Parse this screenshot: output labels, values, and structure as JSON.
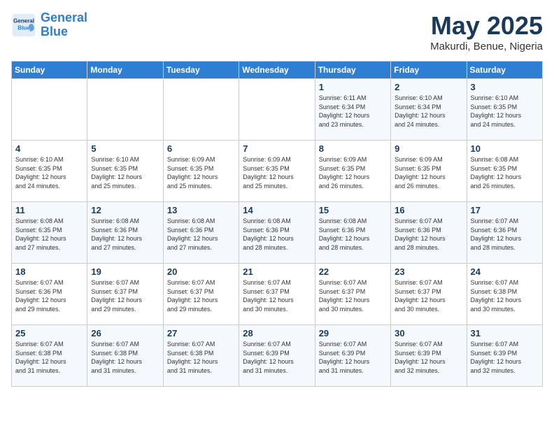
{
  "header": {
    "logo_line1": "General",
    "logo_line2": "Blue",
    "month": "May 2025",
    "location": "Makurdi, Benue, Nigeria"
  },
  "weekdays": [
    "Sunday",
    "Monday",
    "Tuesday",
    "Wednesday",
    "Thursday",
    "Friday",
    "Saturday"
  ],
  "weeks": [
    [
      {
        "day": "",
        "info": ""
      },
      {
        "day": "",
        "info": ""
      },
      {
        "day": "",
        "info": ""
      },
      {
        "day": "",
        "info": ""
      },
      {
        "day": "1",
        "info": "Sunrise: 6:11 AM\nSunset: 6:34 PM\nDaylight: 12 hours\nand 23 minutes."
      },
      {
        "day": "2",
        "info": "Sunrise: 6:10 AM\nSunset: 6:34 PM\nDaylight: 12 hours\nand 24 minutes."
      },
      {
        "day": "3",
        "info": "Sunrise: 6:10 AM\nSunset: 6:35 PM\nDaylight: 12 hours\nand 24 minutes."
      }
    ],
    [
      {
        "day": "4",
        "info": "Sunrise: 6:10 AM\nSunset: 6:35 PM\nDaylight: 12 hours\nand 24 minutes."
      },
      {
        "day": "5",
        "info": "Sunrise: 6:10 AM\nSunset: 6:35 PM\nDaylight: 12 hours\nand 25 minutes."
      },
      {
        "day": "6",
        "info": "Sunrise: 6:09 AM\nSunset: 6:35 PM\nDaylight: 12 hours\nand 25 minutes."
      },
      {
        "day": "7",
        "info": "Sunrise: 6:09 AM\nSunset: 6:35 PM\nDaylight: 12 hours\nand 25 minutes."
      },
      {
        "day": "8",
        "info": "Sunrise: 6:09 AM\nSunset: 6:35 PM\nDaylight: 12 hours\nand 26 minutes."
      },
      {
        "day": "9",
        "info": "Sunrise: 6:09 AM\nSunset: 6:35 PM\nDaylight: 12 hours\nand 26 minutes."
      },
      {
        "day": "10",
        "info": "Sunrise: 6:08 AM\nSunset: 6:35 PM\nDaylight: 12 hours\nand 26 minutes."
      }
    ],
    [
      {
        "day": "11",
        "info": "Sunrise: 6:08 AM\nSunset: 6:35 PM\nDaylight: 12 hours\nand 27 minutes."
      },
      {
        "day": "12",
        "info": "Sunrise: 6:08 AM\nSunset: 6:36 PM\nDaylight: 12 hours\nand 27 minutes."
      },
      {
        "day": "13",
        "info": "Sunrise: 6:08 AM\nSunset: 6:36 PM\nDaylight: 12 hours\nand 27 minutes."
      },
      {
        "day": "14",
        "info": "Sunrise: 6:08 AM\nSunset: 6:36 PM\nDaylight: 12 hours\nand 28 minutes."
      },
      {
        "day": "15",
        "info": "Sunrise: 6:08 AM\nSunset: 6:36 PM\nDaylight: 12 hours\nand 28 minutes."
      },
      {
        "day": "16",
        "info": "Sunrise: 6:07 AM\nSunset: 6:36 PM\nDaylight: 12 hours\nand 28 minutes."
      },
      {
        "day": "17",
        "info": "Sunrise: 6:07 AM\nSunset: 6:36 PM\nDaylight: 12 hours\nand 28 minutes."
      }
    ],
    [
      {
        "day": "18",
        "info": "Sunrise: 6:07 AM\nSunset: 6:36 PM\nDaylight: 12 hours\nand 29 minutes."
      },
      {
        "day": "19",
        "info": "Sunrise: 6:07 AM\nSunset: 6:37 PM\nDaylight: 12 hours\nand 29 minutes."
      },
      {
        "day": "20",
        "info": "Sunrise: 6:07 AM\nSunset: 6:37 PM\nDaylight: 12 hours\nand 29 minutes."
      },
      {
        "day": "21",
        "info": "Sunrise: 6:07 AM\nSunset: 6:37 PM\nDaylight: 12 hours\nand 30 minutes."
      },
      {
        "day": "22",
        "info": "Sunrise: 6:07 AM\nSunset: 6:37 PM\nDaylight: 12 hours\nand 30 minutes."
      },
      {
        "day": "23",
        "info": "Sunrise: 6:07 AM\nSunset: 6:37 PM\nDaylight: 12 hours\nand 30 minutes."
      },
      {
        "day": "24",
        "info": "Sunrise: 6:07 AM\nSunset: 6:38 PM\nDaylight: 12 hours\nand 30 minutes."
      }
    ],
    [
      {
        "day": "25",
        "info": "Sunrise: 6:07 AM\nSunset: 6:38 PM\nDaylight: 12 hours\nand 31 minutes."
      },
      {
        "day": "26",
        "info": "Sunrise: 6:07 AM\nSunset: 6:38 PM\nDaylight: 12 hours\nand 31 minutes."
      },
      {
        "day": "27",
        "info": "Sunrise: 6:07 AM\nSunset: 6:38 PM\nDaylight: 12 hours\nand 31 minutes."
      },
      {
        "day": "28",
        "info": "Sunrise: 6:07 AM\nSunset: 6:39 PM\nDaylight: 12 hours\nand 31 minutes."
      },
      {
        "day": "29",
        "info": "Sunrise: 6:07 AM\nSunset: 6:39 PM\nDaylight: 12 hours\nand 31 minutes."
      },
      {
        "day": "30",
        "info": "Sunrise: 6:07 AM\nSunset: 6:39 PM\nDaylight: 12 hours\nand 32 minutes."
      },
      {
        "day": "31",
        "info": "Sunrise: 6:07 AM\nSunset: 6:39 PM\nDaylight: 12 hours\nand 32 minutes."
      }
    ]
  ]
}
